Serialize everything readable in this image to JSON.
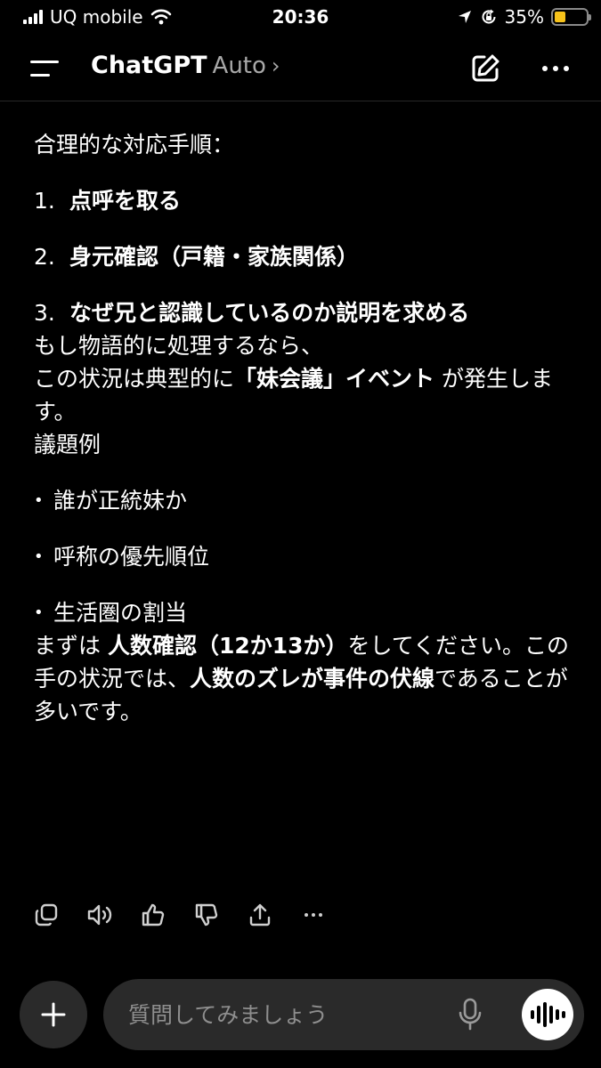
{
  "status_bar": {
    "carrier": "UQ mobile",
    "time": "20:36",
    "battery_percent": "35%",
    "battery_level": 0.35,
    "battery_color": "#f6c21a"
  },
  "header": {
    "title": "ChatGPT",
    "model": "Auto",
    "chevron": "›"
  },
  "message": {
    "intro": "合理的な対応手順：",
    "steps": [
      {
        "num": "1.",
        "text": "点呼を取る"
      },
      {
        "num": "2.",
        "text": "身元確認（戸籍・家族関係）"
      },
      {
        "num": "3.",
        "text": "なぜ兄と認識しているのか説明を求める"
      }
    ],
    "para2": {
      "line1": "もし物語的に処理するなら、",
      "pre": "この状況は典型的に",
      "bold": "「妹会議」イベント",
      "post": " が発生します。"
    },
    "agenda_heading": "議題例",
    "bullets": [
      "誰が正統妹か",
      "呼称の優先順位",
      "生活圏の割当"
    ],
    "para3": {
      "pre": "まずは ",
      "bold1": "人数確認（12か13か）",
      "mid": "をしてください。この手の状況では、",
      "bold2": "人数のズレが事件の伏線",
      "post": "であることが多いです。"
    }
  },
  "input": {
    "placeholder": "質問してみましょう"
  },
  "icons": {
    "menu": "menu-icon",
    "edit": "edit-icon",
    "more": "more-icon",
    "copy": "copy-icon",
    "speaker": "speaker-icon",
    "thumbs_up": "thumbs-up-icon",
    "thumbs_down": "thumbs-down-icon",
    "share": "share-icon",
    "plus": "plus-icon",
    "mic": "mic-icon",
    "voice": "voice-wave-icon"
  }
}
